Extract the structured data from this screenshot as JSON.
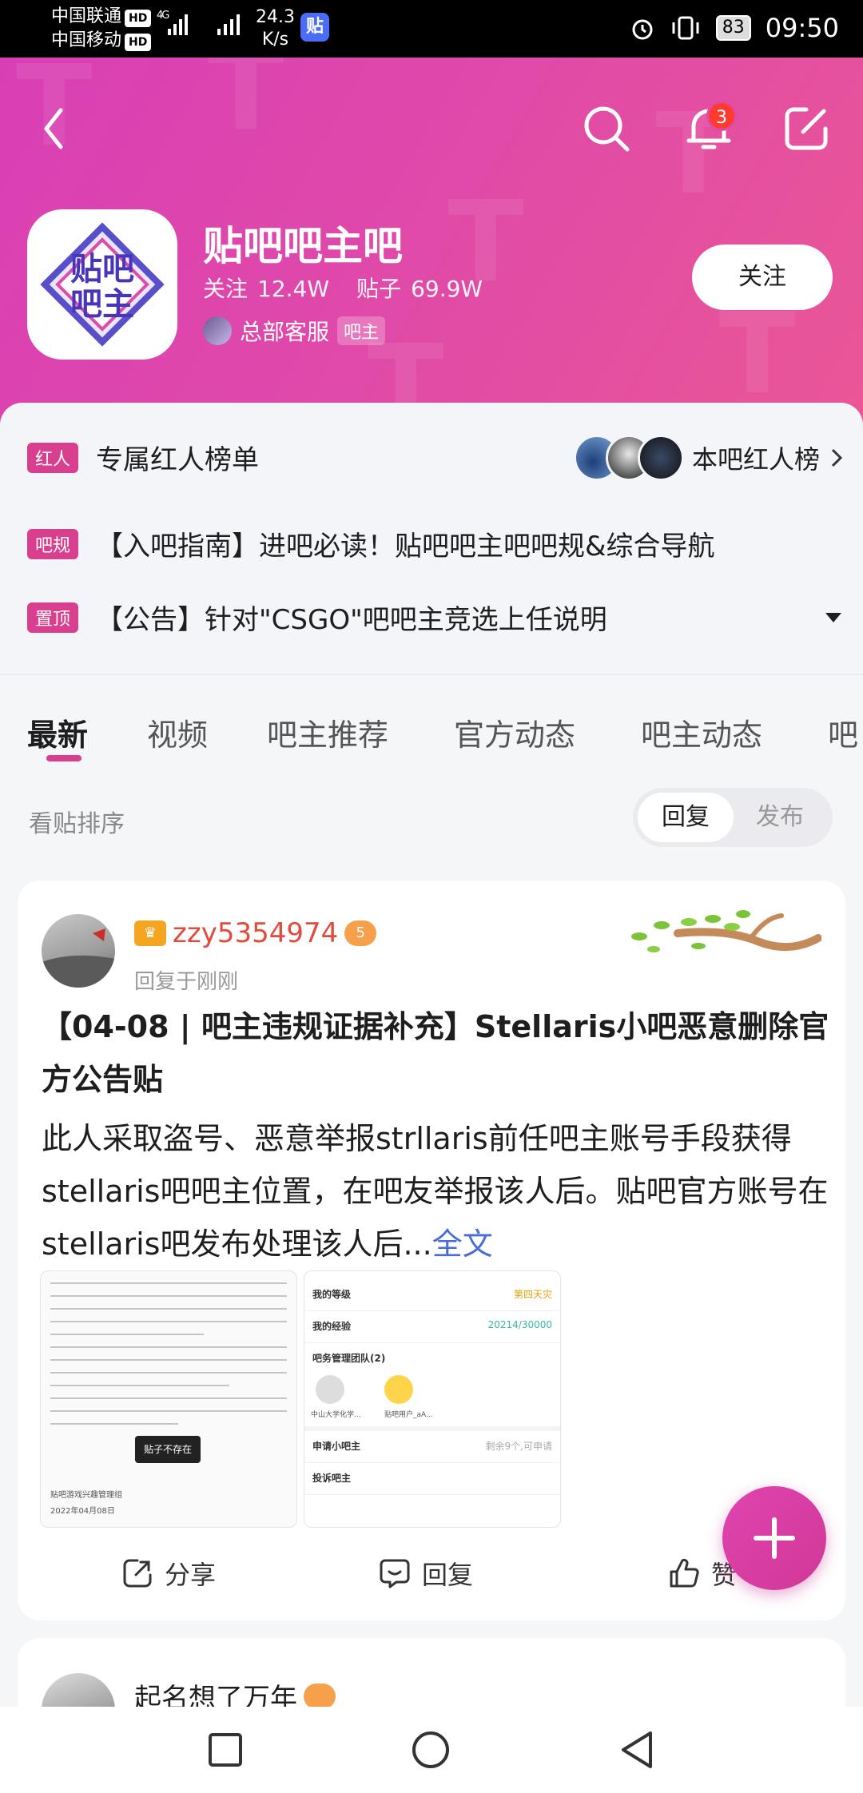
{
  "status_bar": {
    "carrier1": "中国联通",
    "carrier2": "中国移动",
    "hd": "HD",
    "network": "4G",
    "speed_value": "24.3",
    "speed_unit": "K/s",
    "app_icon_text": "贴",
    "battery": "83",
    "time": "09:50"
  },
  "header": {
    "notification_count": "3",
    "forum_name": "贴吧吧主吧",
    "follow_label": "关注",
    "follow_count": "12.4W",
    "posts_label": "贴子",
    "posts_count": "69.9W",
    "admin_name": "总部客服",
    "admin_tag": "吧主",
    "follow_button": "关注",
    "logo_text_line1": "贴吧",
    "logo_text_line2": "吧主"
  },
  "info": {
    "rows": [
      {
        "tag": "红人",
        "text": "专属红人榜单",
        "right": "本吧红人榜"
      },
      {
        "tag": "吧规",
        "text": "【入吧指南】进吧必读！贴吧吧主吧吧规&综合导航"
      },
      {
        "tag": "置顶",
        "text": "【公告】针对\"CSGO\"吧吧主竞选上任说明"
      }
    ]
  },
  "tabs": [
    "最新",
    "视频",
    "吧主推荐",
    "官方动态",
    "吧主动态",
    "吧"
  ],
  "sort": {
    "label": "看贴排序",
    "option_reply": "回复",
    "option_publish": "发布"
  },
  "post": {
    "username": "zzy5354974",
    "level_badge": "5",
    "meta": "回复于刚刚",
    "title": "【04-08 | 吧主违规证据补充】Stellaris小吧恶意删除官方公告贴",
    "body": "此人采取盗号、恶意举报strllaris前任吧主账号手段获得stellaris吧吧主位置，在吧友举报该人后。贴吧官方账号在stellaris吧发布处理该人后...",
    "read_more": "全文",
    "thumb1_overlay": "贴子不存在",
    "thumb1_sign": "贴吧游戏兴趣管理组",
    "thumb1_date": "2022年04月08日",
    "thumb2": {
      "row1_label": "我的等级",
      "row1_value": "第四天灾",
      "row2_label": "我的经验",
      "row2_value": "20214/30000",
      "row3_label": "吧务管理团队(2)",
      "member1": "中山大学化学...",
      "member2": "贴吧用户_aA...",
      "row4_label": "申请小吧主",
      "row4_value": "剩余9个,可申请",
      "row5_label": "投诉吧主"
    },
    "actions": {
      "share": "分享",
      "reply": "回复",
      "like": "赞"
    }
  },
  "post2": {
    "username": "起名想了万年"
  },
  "colors": {
    "header_pink": "#e04aa8",
    "accent": "#d8408f",
    "username_red": "#e24b3b",
    "link_blue": "#4a6cd8"
  }
}
